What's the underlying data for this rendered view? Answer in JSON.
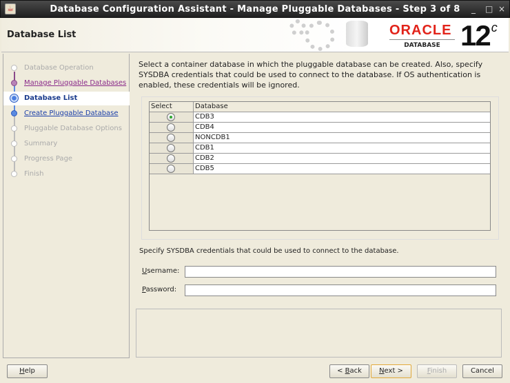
{
  "window": {
    "title": "Database Configuration Assistant - Manage Pluggable Databases - Step 3 of 8",
    "controls": [
      "_",
      "□",
      "×"
    ]
  },
  "header": {
    "page_title": "Database List",
    "logo_brand": "ORACLE",
    "logo_product": "DATABASE",
    "logo_version": "12",
    "logo_version_sup": "c"
  },
  "steps": [
    {
      "label": "Database Operation",
      "state": "disabled"
    },
    {
      "label": "Manage Pluggable Databases",
      "state": "visited"
    },
    {
      "label": "Database List",
      "state": "current"
    },
    {
      "label": "Create Pluggable Database",
      "state": "link"
    },
    {
      "label": "Pluggable Database Options",
      "state": "disabled"
    },
    {
      "label": "Summary",
      "state": "disabled"
    },
    {
      "label": "Progress Page",
      "state": "disabled"
    },
    {
      "label": "Finish",
      "state": "disabled"
    }
  ],
  "main": {
    "description": "Select a container database in which the pluggable database can be created. Also, specify SYSDBA credentials that could be used to connect to the database. If OS authentication is enabled, these credentials will be ignored.",
    "table": {
      "headers": [
        "Select",
        "Database"
      ],
      "rows": [
        {
          "db": "CDB3",
          "selected": true
        },
        {
          "db": "CDB4",
          "selected": false
        },
        {
          "db": "NONCDB1",
          "selected": false
        },
        {
          "db": "CDB1",
          "selected": false
        },
        {
          "db": "CDB2",
          "selected": false
        },
        {
          "db": "CDB5",
          "selected": false
        }
      ]
    },
    "credentials_label": "Specify SYSDBA credentials that could be used to connect to the database.",
    "username_label_u": "U",
    "username_label_rest": "sername:",
    "username_value": "",
    "password_label_u": "P",
    "password_label_rest": "assword:",
    "password_value": ""
  },
  "buttons": {
    "help_u": "H",
    "help_rest": "elp",
    "back_pre": "< ",
    "back_u": "B",
    "back_rest": "ack",
    "next_u": "N",
    "next_rest": "ext >",
    "finish_u": "F",
    "finish_rest": "inish",
    "cancel": "Cancel"
  },
  "colors": {
    "accent": "#1a3b8c",
    "visited": "#8a2a8a",
    "oracle_red": "#e2231a"
  }
}
